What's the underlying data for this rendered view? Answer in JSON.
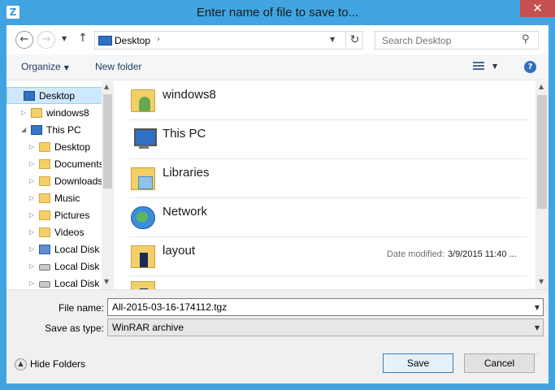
{
  "window": {
    "title": "Enter name of file to save to...",
    "app_icon_letter": "Z",
    "close_label": "✕"
  },
  "nav": {
    "back_icon": "←",
    "forward_icon": "→",
    "recent_icon": "▼",
    "up_icon": "↑",
    "address_location": "Desktop",
    "address_chevron": "›",
    "address_dropdown": "▼",
    "refresh_icon": "↻",
    "search_placeholder": "Search Desktop",
    "search_icon": "⚲"
  },
  "toolbar": {
    "organize_label": "Organize",
    "organize_arrow": "▼",
    "new_folder_label": "New folder",
    "views_dropdown": "▼",
    "help_label": "?"
  },
  "nav_pane": {
    "expand_collapsed": "▷",
    "expand_open": "◢",
    "scroll_up": "▲",
    "scroll_down": "▼",
    "items": [
      {
        "label": "Desktop",
        "icon": "desktop-icon",
        "expander": "",
        "indent": 0,
        "selected": true
      },
      {
        "label": "windows8",
        "icon": "user-folder-icon",
        "expander": "collapsed",
        "indent": 1,
        "selected": false
      },
      {
        "label": "This PC",
        "icon": "computer-icon",
        "expander": "open",
        "indent": 1,
        "selected": false
      },
      {
        "label": "Desktop",
        "icon": "desktop-folder-icon",
        "expander": "collapsed",
        "indent": 2,
        "selected": false
      },
      {
        "label": "Documents",
        "icon": "documents-folder-icon",
        "expander": "collapsed",
        "indent": 2,
        "selected": false
      },
      {
        "label": "Downloads",
        "icon": "downloads-folder-icon",
        "expander": "collapsed",
        "indent": 2,
        "selected": false
      },
      {
        "label": "Music",
        "icon": "music-folder-icon",
        "expander": "collapsed",
        "indent": 2,
        "selected": false
      },
      {
        "label": "Pictures",
        "icon": "pictures-folder-icon",
        "expander": "collapsed",
        "indent": 2,
        "selected": false
      },
      {
        "label": "Videos",
        "icon": "videos-folder-icon",
        "expander": "collapsed",
        "indent": 2,
        "selected": false
      },
      {
        "label": "Local Disk",
        "icon": "system-disk-icon",
        "expander": "collapsed",
        "indent": 2,
        "selected": false
      },
      {
        "label": "Local Disk",
        "icon": "disk-drive-icon",
        "expander": "collapsed",
        "indent": 2,
        "selected": false
      },
      {
        "label": "Local Disk",
        "icon": "disk-drive-icon",
        "expander": "collapsed",
        "indent": 2,
        "selected": false
      }
    ]
  },
  "content": {
    "scroll_up": "▲",
    "scroll_down": "▼",
    "items": [
      {
        "name": "windows8",
        "icon": "user-folder-icon",
        "date_label": "",
        "date_value": ""
      },
      {
        "name": "This PC",
        "icon": "computer-icon",
        "date_label": "",
        "date_value": ""
      },
      {
        "name": "Libraries",
        "icon": "libraries-icon",
        "date_label": "",
        "date_value": ""
      },
      {
        "name": "Network",
        "icon": "network-icon",
        "date_label": "",
        "date_value": ""
      },
      {
        "name": "layout",
        "icon": "folder-icon",
        "date_label": "Date modified:",
        "date_value": "3/9/2015 11:40 ..."
      }
    ]
  },
  "footer": {
    "file_name_label": "File name:",
    "file_name_value": "All-2015-03-16-174112.tgz",
    "save_type_label": "Save as type:",
    "save_type_value": "WinRAR archive",
    "dropdown_arrow": "▼",
    "hide_folders_label": "Hide Folders",
    "hide_folders_icon": "▲",
    "save_label": "Save",
    "cancel_label": "Cancel",
    "grip": "⋰"
  },
  "colors": {
    "title_bar": "#41a4e0",
    "close_button": "#c75050",
    "selection": "#cde8ff",
    "default_button_border": "#3c7fb1"
  }
}
